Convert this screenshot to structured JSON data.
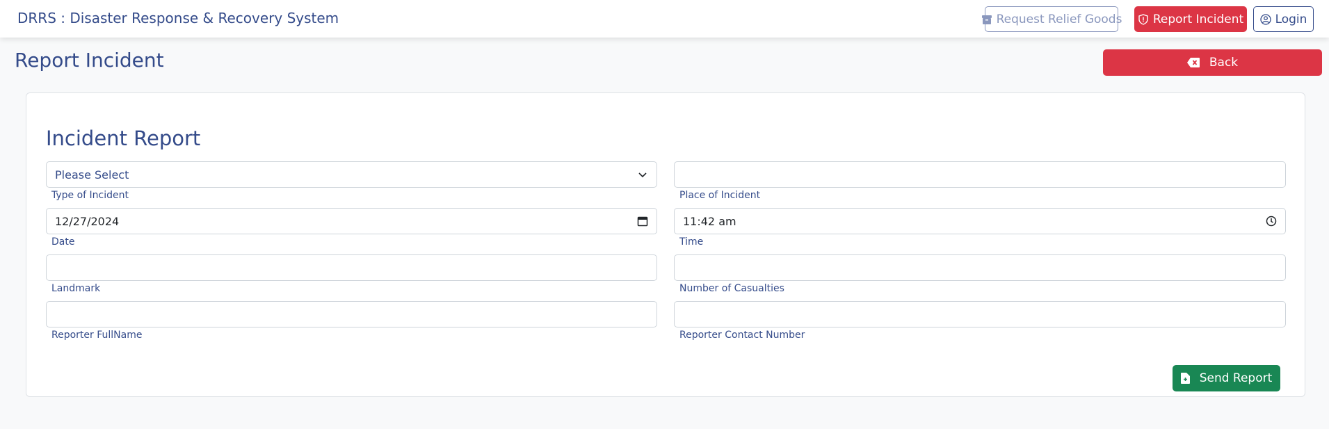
{
  "header": {
    "brand": "DRRS : Disaster Response & Recovery System",
    "buttons": {
      "relief": "Request Relief Goods",
      "report": "Report Incident",
      "login": "Login"
    }
  },
  "page": {
    "title": "Report Incident",
    "back_label": "Back"
  },
  "form": {
    "title": "Incident Report",
    "type_of_incident": {
      "value": "Please Select",
      "label": "Type of Incident"
    },
    "place_of_incident": {
      "value": "",
      "label": "Place of Incident"
    },
    "date": {
      "value": "12/27/2024",
      "label": "Date"
    },
    "time": {
      "value": "11:42 am",
      "label": "Time"
    },
    "landmark": {
      "value": "",
      "label": "Landmark"
    },
    "casualties": {
      "value": "",
      "label": "Number of Casualties"
    },
    "reporter_name": {
      "value": "",
      "label": "Reporter FullName"
    },
    "reporter_contact": {
      "value": "",
      "label": "Reporter Contact Number"
    },
    "submit_label": "Send Report"
  },
  "icons": {
    "relief": "box-icon",
    "report": "shield-exclamation-icon",
    "login": "user-circle-icon",
    "back": "backspace-icon",
    "select": "chevron-down-icon",
    "date": "calendar-icon",
    "time": "clock-icon",
    "send": "file-plus-icon"
  },
  "colors": {
    "primary_text": "#344b8a",
    "danger": "#dc3545",
    "success": "#198754",
    "muted": "#8a97bd"
  }
}
